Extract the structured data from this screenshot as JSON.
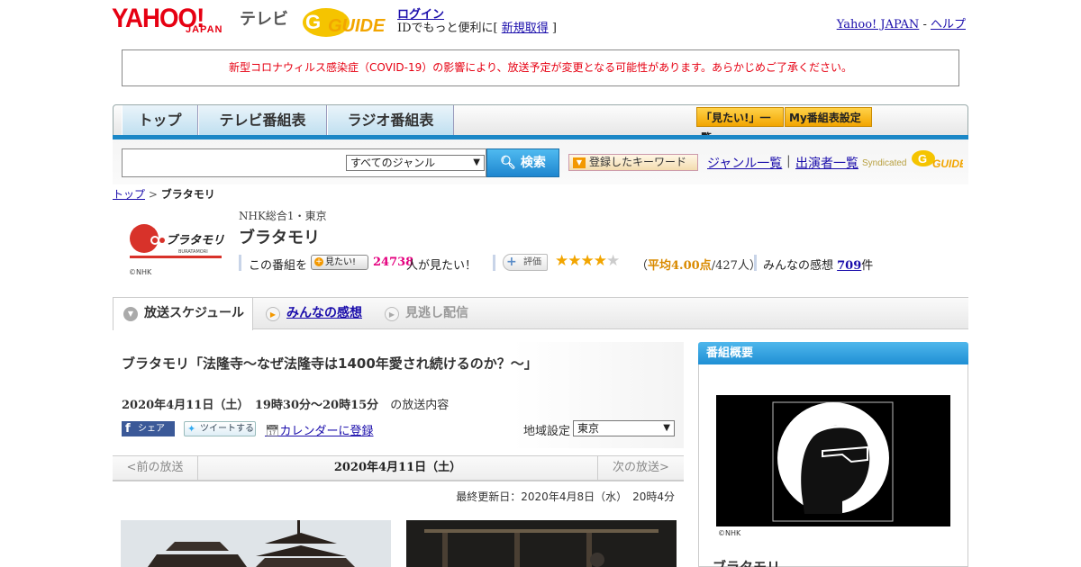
{
  "header": {
    "logo_yahoo": "YAHOO!",
    "logo_japan": "JAPAN",
    "logo_tv": "テレビ",
    "logo_gguide": "GUIDE",
    "login_label": "ログイン",
    "login_sub_prefix": "IDでもっと便利に[ ",
    "signup_label": "新規取得",
    "login_sub_suffix": " ]",
    "yahoo_japan_link": "Yahoo! JAPAN",
    "separator": " - ",
    "help_link": "ヘルプ"
  },
  "notice": "新型コロナウィルス感染症（COVID-19）の影響により、放送予定が変更となる可能性があります。あらかじめご了承ください。",
  "global_nav": {
    "tabs": [
      "トップ",
      "テレビ番組表",
      "ラジオ番組表"
    ],
    "want_list_button": "「見たい!」一覧",
    "my_schedule_button": "My番組表設定"
  },
  "search": {
    "genre_selected": "すべてのジャンル",
    "search_button": "検索",
    "keyword_button": "登録したキーワード",
    "genre_list_link": "ジャンル一覧",
    "link_separator": "|",
    "cast_list_link": "出演者一覧",
    "syndicated": "Syndicated"
  },
  "breadcrumb": {
    "top": "トップ",
    "sep": " > ",
    "current": "ブラタモリ"
  },
  "program": {
    "logo_text": "ブラタモリ",
    "logo_sub": "BURATAMORI",
    "logo_credit": "©NHK",
    "channel": "NHK総合1・東京",
    "title": "ブラタモリ",
    "want_prefix": "この番組を",
    "want_button": "見たい!",
    "want_count": "24738",
    "want_suffix": "人が見たい！",
    "rate_button": "評価",
    "rating_value": 4.0,
    "rating_max": 5,
    "avg_open": "（",
    "avg_value": "平均4.00点",
    "avg_tail": "/427人）",
    "reviews_prefix": "みんなの感想 ",
    "reviews_count": "709",
    "reviews_suffix": "件"
  },
  "sub_tabs": {
    "schedule": "放送スケジュール",
    "reviews": "みんなの感想",
    "vod": "見逃し配信"
  },
  "episode": {
    "title": "ブラタモリ「法隆寺～なぜ法隆寺は1400年愛され続けるのか？～」",
    "datetime": "2020年4月11日（土）　19時30分～20時15分",
    "datetime_suffix": "の放送内容",
    "share_facebook": "シェア",
    "share_twitter": "ツイートする",
    "calendar_link": "カレンダーに登録",
    "region_label": "地域設定",
    "region_value": "東京"
  },
  "date_nav": {
    "prev": "<前の放送",
    "current": "2020年4月11日（土）",
    "next": "次の放送>"
  },
  "updated": "最終更新日：2020年4月8日（水）　20時4分",
  "sidebar": {
    "heading": "番組概要",
    "image_credit": "©NHK",
    "title": "ブラタモリ"
  },
  "colors": {
    "accent_blue": "#1b87c6",
    "notice_red": "#e60012",
    "want_pink": "#e4007f",
    "star_orange": "#f2a500"
  }
}
